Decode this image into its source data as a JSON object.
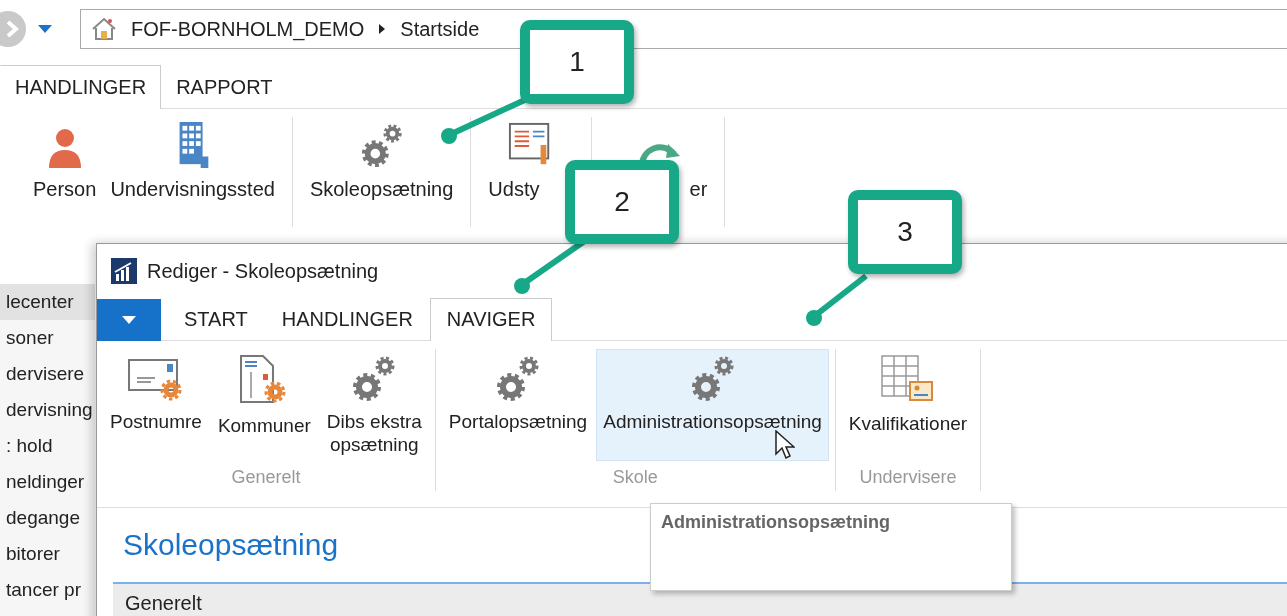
{
  "address": {
    "path": [
      {
        "label": "FOF-BORNHOLM_DEMO"
      },
      {
        "label": "Startside"
      }
    ]
  },
  "main_tabs": [
    {
      "label": "HANDLINGER",
      "selected": true
    },
    {
      "label": "RAPPORT",
      "selected": false
    }
  ],
  "main_ribbon": [
    {
      "label": "Person",
      "kind": "person"
    },
    {
      "label": "Undervisningssted",
      "kind": "building"
    },
    {
      "label": "Skoleopsætning",
      "kind": "gears"
    },
    {
      "label": "Udsty",
      "kind": "report"
    },
    {
      "label": "er",
      "kind": "refresh"
    }
  ],
  "sidebar_items": [
    {
      "label": "lecenter",
      "selected": true
    },
    {
      "label": "soner",
      "selected": false
    },
    {
      "label": "dervisere",
      "selected": false
    },
    {
      "label": "dervisning",
      "selected": false
    },
    {
      "label": ": hold",
      "selected": false
    },
    {
      "label": "neldinger",
      "selected": false
    },
    {
      "label": "degange",
      "selected": false
    },
    {
      "label": "bitorer",
      "selected": false
    },
    {
      "label": "tancer pr",
      "selected": false
    }
  ],
  "dialog": {
    "title": "Rediger - Skoleopsætning",
    "tabs": [
      {
        "label": "START",
        "selected": false
      },
      {
        "label": "HANDLINGER",
        "selected": false
      },
      {
        "label": "NAVIGER",
        "selected": true
      }
    ],
    "groups": [
      {
        "label": "Generelt",
        "actions": [
          {
            "label": "Postnumre",
            "kind": "envelope-gear",
            "highlighted": false
          },
          {
            "label": "Kommuner",
            "kind": "document-gear",
            "highlighted": false
          },
          {
            "label": "Dibs ekstra\nopsætning",
            "kind": "gears",
            "highlighted": false
          }
        ]
      },
      {
        "label": "Skole",
        "actions": [
          {
            "label": "Portalopsætning",
            "kind": "gears",
            "highlighted": false
          },
          {
            "label": "Administrationsopsætning",
            "kind": "gears",
            "highlighted": true
          }
        ]
      },
      {
        "label": "Undervisere",
        "actions": [
          {
            "label": "Kvalifikationer",
            "kind": "grid-card",
            "highlighted": false
          }
        ]
      }
    ],
    "heading": "Skoleopsætning",
    "section": "Generelt",
    "tooltip": "Administrationsopsætning"
  },
  "callouts": [
    {
      "number": "1"
    },
    {
      "number": "2"
    },
    {
      "number": "3"
    }
  ]
}
